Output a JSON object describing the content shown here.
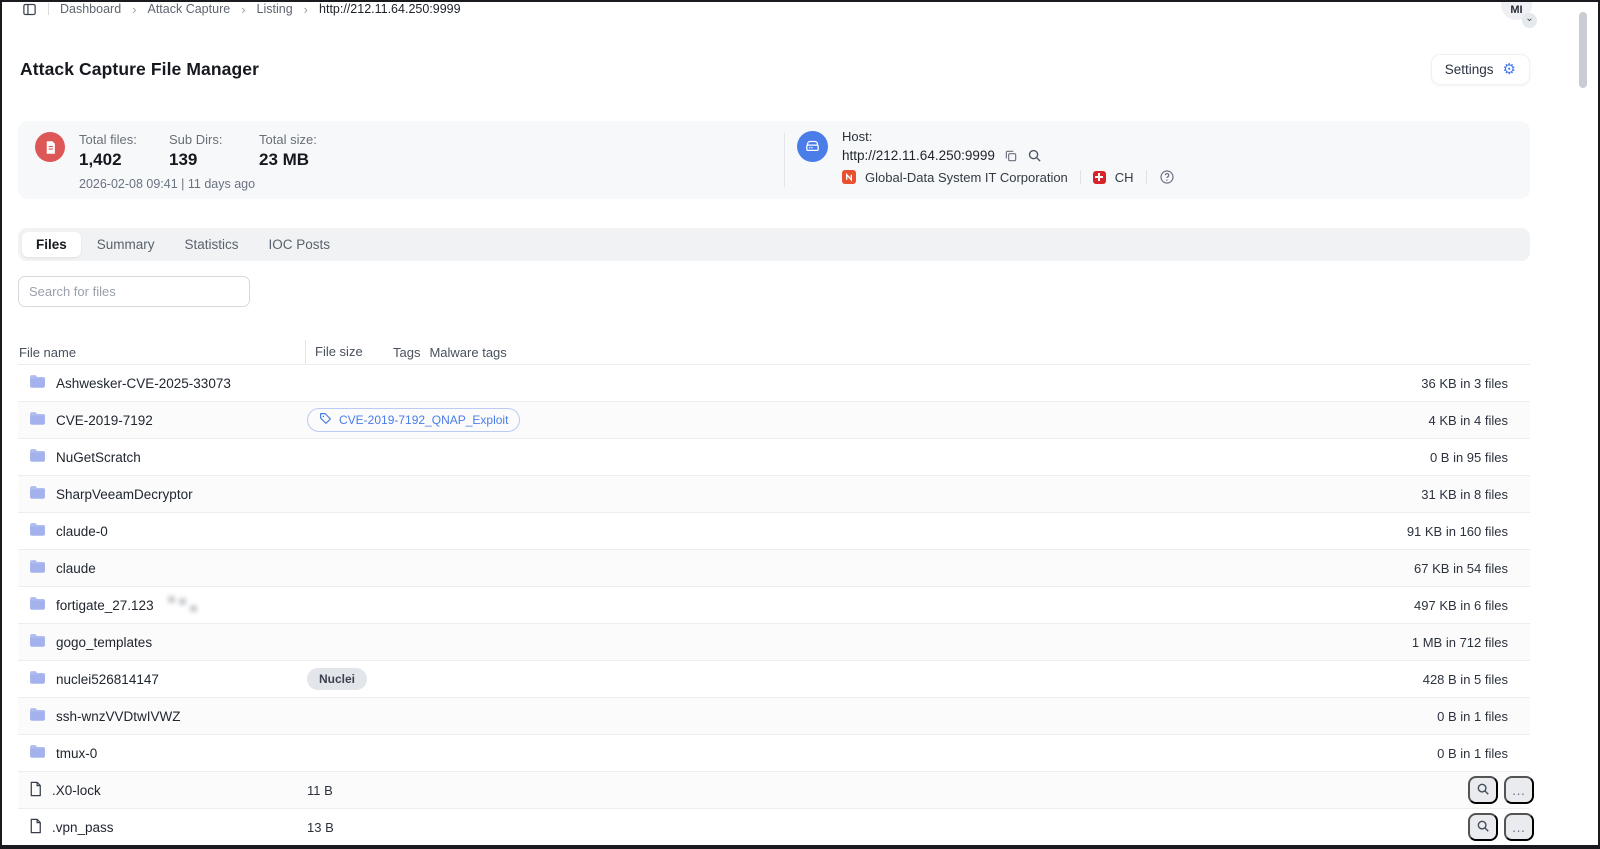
{
  "topbar": {
    "breadcrumb": [
      "Dashboard",
      "Attack Capture",
      "Listing",
      "http://212.11.64.250:9999"
    ],
    "avatar_initials": "MI"
  },
  "header": {
    "title": "Attack Capture File Manager",
    "settings_label": "Settings"
  },
  "overview": {
    "stats": [
      {
        "label": "Total files:",
        "value": "1,402"
      },
      {
        "label": "Sub Dirs:",
        "value": "139"
      },
      {
        "label": "Total size:",
        "value": "23 MB"
      }
    ],
    "timestamp": "2026-02-08 09:41 | 11 days ago",
    "host": {
      "label": "Host:",
      "url": "http://212.11.64.250:9999",
      "asn_org": "Global-Data System IT Corporation",
      "country_code": "CH"
    }
  },
  "tabs": [
    {
      "label": "Files",
      "active": true
    },
    {
      "label": "Summary",
      "active": false
    },
    {
      "label": "Statistics",
      "active": false
    },
    {
      "label": "IOC Posts",
      "active": false
    }
  ],
  "search": {
    "placeholder": "Search for files"
  },
  "table": {
    "columns": [
      "File name",
      "File size",
      "Tags",
      "Malware tags"
    ],
    "rows": [
      {
        "type": "folder",
        "name": "Ashwesker-CVE-2025-33073",
        "size": "",
        "tag": null,
        "total": "36 KB in 3 files",
        "actions": false,
        "redacted": false
      },
      {
        "type": "folder",
        "name": "CVE-2019-7192",
        "size": "",
        "tag": {
          "label": "CVE-2019-7192_QNAP_Exploit",
          "style": "cve"
        },
        "total": "4 KB in 4 files",
        "actions": false,
        "redacted": false
      },
      {
        "type": "folder",
        "name": "NuGetScratch",
        "size": "",
        "tag": null,
        "total": "0 B in 95 files",
        "actions": false,
        "redacted": false
      },
      {
        "type": "folder",
        "name": "SharpVeeamDecryptor",
        "size": "",
        "tag": null,
        "total": "31 KB in 8 files",
        "actions": false,
        "redacted": false
      },
      {
        "type": "folder",
        "name": "claude-0",
        "size": "",
        "tag": null,
        "total": "91 KB in 160 files",
        "actions": false,
        "redacted": false
      },
      {
        "type": "folder",
        "name": "claude",
        "size": "",
        "tag": null,
        "total": "67 KB in 54 files",
        "actions": false,
        "redacted": false
      },
      {
        "type": "folder",
        "name": "fortigate_27.123",
        "size": "",
        "tag": null,
        "total": "497 KB in 6 files",
        "actions": false,
        "redacted": true
      },
      {
        "type": "folder",
        "name": "gogo_templates",
        "size": "",
        "tag": null,
        "total": "1 MB in 712 files",
        "actions": false,
        "redacted": false
      },
      {
        "type": "folder",
        "name": "nuclei526814147",
        "size": "",
        "tag": {
          "label": "Nuclei",
          "style": "plain"
        },
        "total": "428 B in 5 files",
        "actions": false,
        "redacted": false
      },
      {
        "type": "folder",
        "name": "ssh-wnzVVDtwIVWZ",
        "size": "",
        "tag": null,
        "total": "0 B in 1 files",
        "actions": false,
        "redacted": false
      },
      {
        "type": "folder",
        "name": "tmux-0",
        "size": "",
        "tag": null,
        "total": "0 B in 1 files",
        "actions": false,
        "redacted": false
      },
      {
        "type": "file",
        "name": ".X0-lock",
        "size": "11 B",
        "tag": null,
        "total": "",
        "actions": true,
        "redacted": false
      },
      {
        "type": "file",
        "name": ".vpn_pass",
        "size": "13 B",
        "tag": null,
        "total": "",
        "actions": true,
        "redacted": false
      }
    ]
  },
  "icons": {
    "gear_glyph": "⚙",
    "more_glyph": "…",
    "breadcrumb_sep": "›",
    "avatar_chevron": "⌄"
  },
  "colors": {
    "accent_blue": "#4a7de8",
    "stat_icon_bg": "#dc5755",
    "host_icon_bg": "#4a7de8",
    "asn_icon_bg": "#e8512f",
    "flag_red": "#d8232a",
    "folder_icon": "#a3b2ec"
  }
}
